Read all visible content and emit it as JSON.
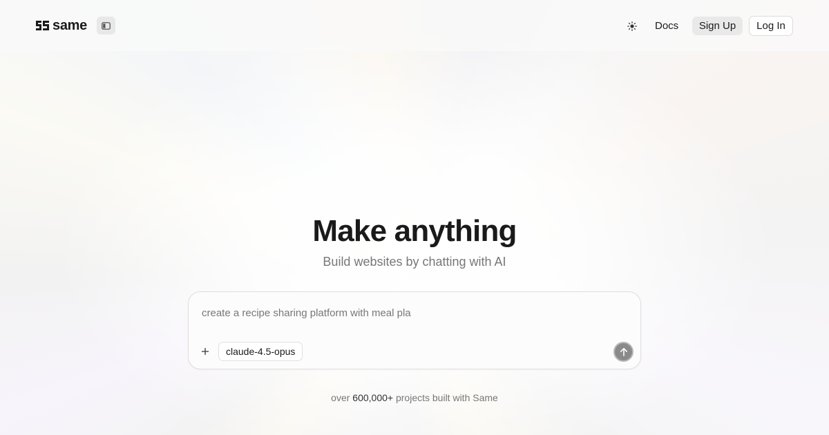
{
  "header": {
    "logo_text": "same",
    "sidebar_toggle_icon": "sidebar-toggle-icon",
    "theme_icon": "sun-icon",
    "docs_label": "Docs",
    "signup_label": "Sign Up",
    "login_label": "Log In"
  },
  "hero": {
    "title": "Make anything",
    "subtitle": "Build websites by chatting with AI"
  },
  "prompt": {
    "value": "create a recipe sharing platform with meal pla",
    "attach_icon": "plus-icon",
    "model": "claude-4.5-opus",
    "send_icon": "arrow-up-icon"
  },
  "footer": {
    "prefix": "over ",
    "count": "600,000+",
    "suffix": " projects built with Same"
  },
  "colors": {
    "text": "#1a1a1a",
    "muted": "#777777",
    "send_button": "#8a8a8a"
  }
}
